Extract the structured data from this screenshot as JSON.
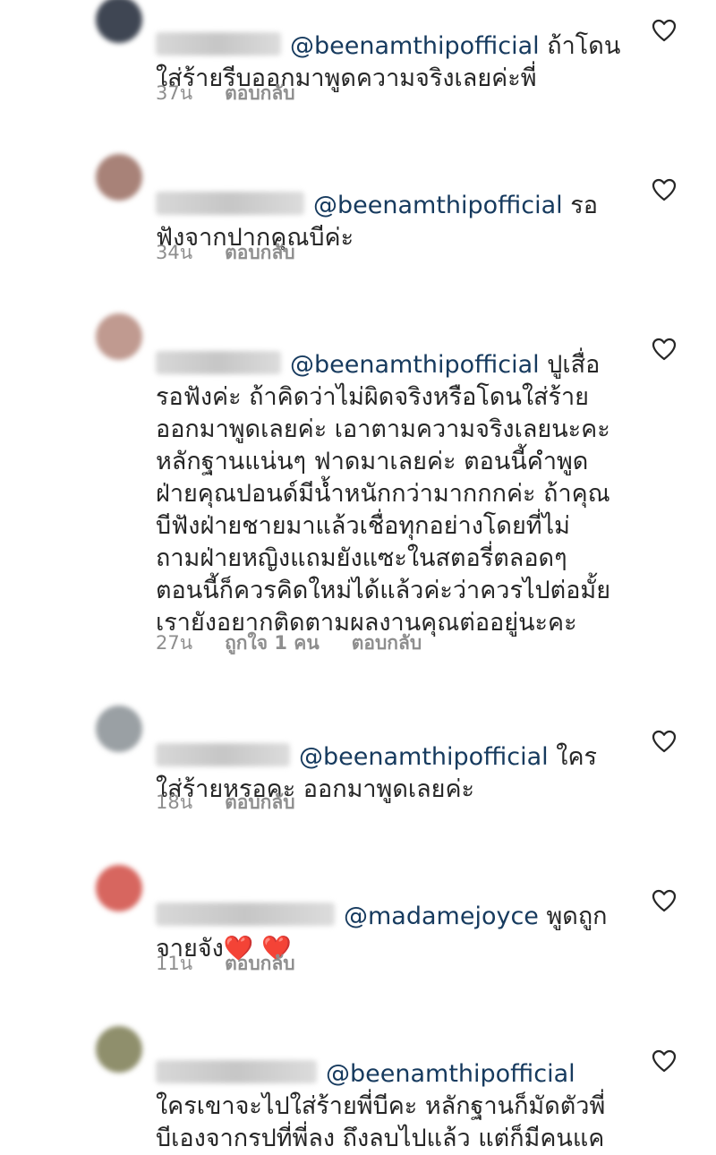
{
  "comments": [
    {
      "avatar_color": "#3f4653",
      "mention": "@beenamthipofficial",
      "text": " ถ้าโดน\nใส่ร้ายรีบออกมาพูดความจริงเลยค่ะพี่",
      "time": "37น",
      "reply": "ตอบกลับ",
      "likes": "",
      "like_icon": "heart-outline-icon"
    },
    {
      "avatar_color": "#a88278",
      "mention": "@beenamthipofficial",
      "text": " รอ\nฟังจากปากคุณบีค่ะ",
      "time": "34น",
      "reply": "ตอบกลับ",
      "likes": "",
      "like_icon": "heart-outline-icon"
    },
    {
      "avatar_color": "#c09a90",
      "mention": "@beenamthipofficial",
      "text": "  ปูเสื่อ\nรอฟังค่ะ ถ้าคิดว่าไม่ผิดจริงหรือโดนใส่ร้าย\nออกมาพูดเลยค่ะ เอาตามความจริงเลยนะคะ\nหลักฐานแน่นๆ ฟาดมาเลยค่ะ ตอนนี้คำพูด\nฝ่ายคุณปอนด์มีน้ำหนักกว่ามากกกค่ะ ถ้าคุณ\nบีฟังฝ่ายชายมาแล้วเชื่อทุกอย่างโดยที่ไม่\nถามฝ่ายหญิงแถมยังแซะในสตอรี่ตลอดๆ\nตอนนี้ก็ควรคิดใหม่ได้แล้วค่ะว่าควรไปต่อมั้ย\nเรายังอยากติดตามผลงานคุณต่ออยู่นะคะ",
      "time": "27น",
      "likes": "ถูกใจ 1 คน",
      "reply": "ตอบกลับ",
      "like_icon": "heart-outline-icon"
    },
    {
      "avatar_color": "#9aa0a4",
      "mention": "@beenamthipofficial",
      "text": " ใคร\nใส่ร้ายหรอคะ ออกมาพูดเลยค่ะ",
      "time": "18น",
      "reply": "ตอบกลับ",
      "likes": "",
      "like_icon": "heart-outline-icon"
    },
    {
      "avatar_color": "#d7665f",
      "mention": "@madamejoyce",
      "text": " พูดถูก\nจายจัง❤️ ❤️",
      "time": "11น",
      "reply": "ตอบกลับ",
      "likes": "",
      "like_icon": "heart-outline-icon"
    },
    {
      "avatar_color": "#8f8f6c",
      "mention": "@beenamthipofficial",
      "text": "\nใครเขาจะไปใส่ร้ายพี่บีคะ หลักฐานก็มัดตัวพี่\nบีเองจากรปที่พี่ลง ถึงลบไปแล้ว แต่ก็มีคนแค",
      "time": "",
      "reply": "",
      "likes": "",
      "like_icon": "heart-outline-icon"
    }
  ]
}
